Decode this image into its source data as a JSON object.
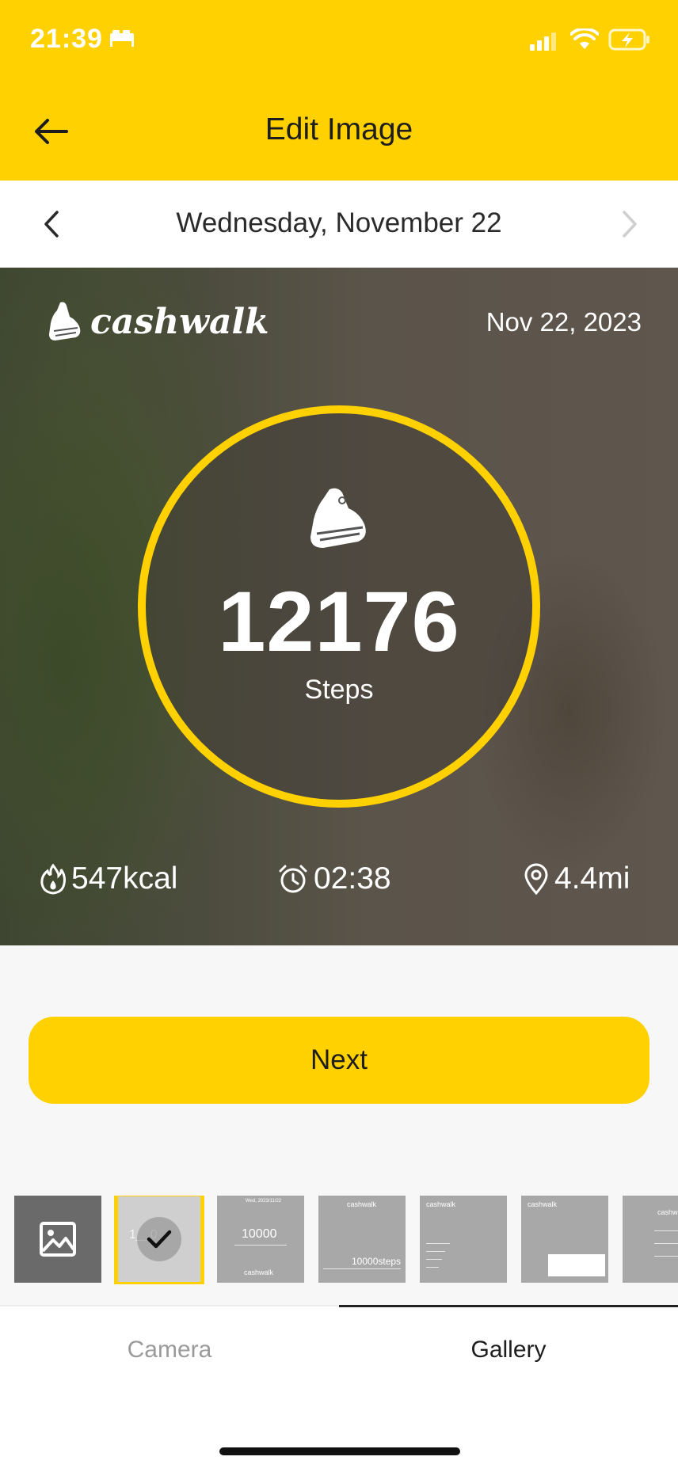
{
  "status_bar": {
    "time": "21:39",
    "icons": [
      "bed-icon",
      "signal-icon",
      "wifi-icon",
      "battery-charging-icon"
    ]
  },
  "header": {
    "title": "Edit Image",
    "back_icon": "arrow-left-icon"
  },
  "date_nav": {
    "label": "Wednesday, November 22",
    "prev_icon": "chevron-left-icon",
    "next_icon": "chevron-right-icon"
  },
  "photo": {
    "brand": "cashwalk",
    "date": "Nov 22, 2023",
    "steps_value": "12176",
    "steps_label": "Steps",
    "stats": {
      "kcal": "547kcal",
      "time": "02:38",
      "distance": "4.4mi"
    }
  },
  "actions": {
    "next_label": "Next"
  },
  "thumbnails": {
    "selected_index": 1,
    "items": [
      {
        "type": "open-gallery"
      },
      {
        "label": "1__0"
      },
      {
        "label": "10000"
      },
      {
        "label": "10000steps"
      },
      {
        "label": "cashwalk"
      },
      {
        "label": "cashwalk"
      },
      {
        "label": "cashwalk"
      }
    ],
    "t2_top": "Wed, 2023/11/22",
    "t2_brand": "cashwalk",
    "t3_brand": "cashwalk",
    "t4_brand": "cashwalk",
    "t5_brand": "cashwalk",
    "t6_brand": "cashwalk"
  },
  "tabs": {
    "camera": "Camera",
    "gallery": "Gallery",
    "active": "Gallery"
  },
  "colors": {
    "accent": "#FFD100",
    "tab_active": "#1d1d1d",
    "tab_inactive": "#9a9a9a"
  }
}
